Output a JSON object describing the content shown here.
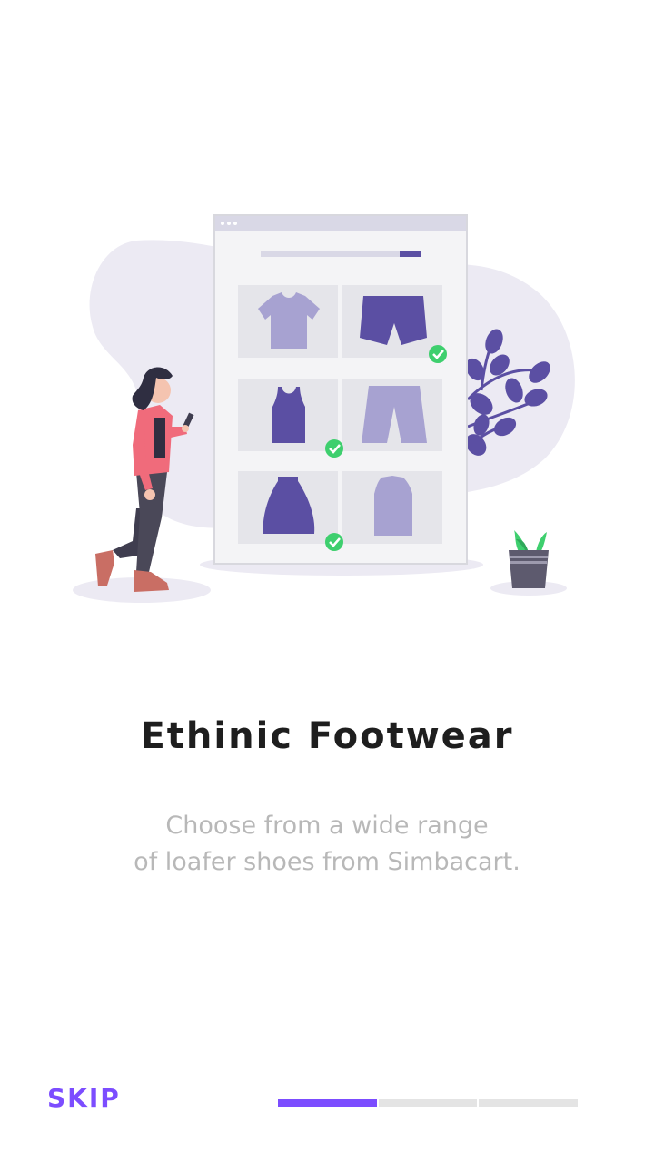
{
  "onboarding": {
    "title": "Ethinic Footwear",
    "description_lines": [
      "Choose from a wide range",
      "of loafer shoes from Simbacart."
    ],
    "skip_label": "SKIP",
    "progress": {
      "total_steps": 3,
      "current_step": 1
    },
    "illustration": {
      "icon": "online-shopping-illustration",
      "colors": {
        "accent": "#7c4dff",
        "purple_dark": "#5b4fa3",
        "purple_light": "#a7a2d1",
        "check_green": "#3ecf6e",
        "shirt_pink": "#f06b7b",
        "blob": "#eceaf3"
      }
    }
  }
}
